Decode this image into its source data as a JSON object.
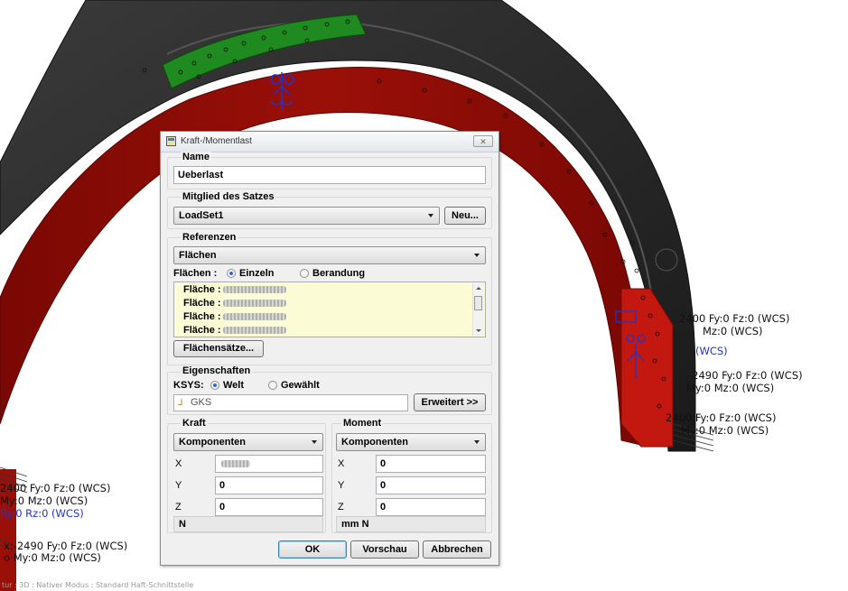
{
  "window": {
    "title": "Kraft-/Momentlast",
    "close_glyph": "✕"
  },
  "name_section": {
    "label": "Name",
    "value": "Ueberlast"
  },
  "member_section": {
    "label": "Mitglied des Satzes",
    "selected": "LoadSet1",
    "new_button": "Neu..."
  },
  "references": {
    "label": "Referenzen",
    "type_selected": "Flächen",
    "mode_label": "Flächen :",
    "mode_single": "Einzeln",
    "mode_boundary": "Berandung",
    "items": [
      "Fläche :",
      "Fläche :",
      "Fläche :",
      "Fläche :"
    ],
    "surface_sets_button": "Flächensätze..."
  },
  "properties": {
    "label": "Eigenschaften",
    "csys_label": "KSYS:",
    "csys_world": "Welt",
    "csys_selected": "Gewählt",
    "csys_value": "GKS",
    "advanced_button": "Erweitert >>"
  },
  "force": {
    "label": "Kraft",
    "type_selected": "Komponenten",
    "x_label": "X",
    "x_value": "",
    "y_label": "Y",
    "y_value": "0",
    "z_label": "Z",
    "z_value": "0",
    "unit": "N"
  },
  "moment": {
    "label": "Moment",
    "type_selected": "Komponenten",
    "x_label": "X",
    "x_value": "0",
    "y_label": "Y",
    "y_value": "0",
    "z_label": "Z",
    "z_value": "0",
    "unit": "mm N"
  },
  "buttons": {
    "ok": "OK",
    "preview": "Vorschau",
    "cancel": "Abbrechen"
  },
  "annotations": {
    "right_1a": "2400 Fy:0 Fz:0 (WCS)",
    "right_1b": "Mz:0 (WCS)",
    "right_1c": "(WCS)",
    "right_2a": "-2490 Fy:0 Fz:0 (WCS)",
    "right_2b": "My:0 Mz:0 (WCS)",
    "right_3a": "2400 Fy:0 Fz:0 (WCS)",
    "right_3b": "My:0 Mz:0 (WCS)",
    "left_1a": "2400 Fy:0 Fz:0 (WCS)",
    "left_1b": "My:0 Mz:0 (WCS)",
    "left_1c": "Ry:0 Rz:0 (WCS)",
    "left_2a": "x:-2490 Fy:0 Fz:0 (WCS)",
    "left_2b": "o My:0 Mz:0 (WCS)"
  },
  "status_text": "tur : 3D : Nativer Modus : Standard Haft-Schnittstelle",
  "colors": {
    "body": "#2b2b2b",
    "red_band": "#8c0a06",
    "green_patch": "#1f8a1f",
    "dialog_bg": "#f0f0f0"
  }
}
